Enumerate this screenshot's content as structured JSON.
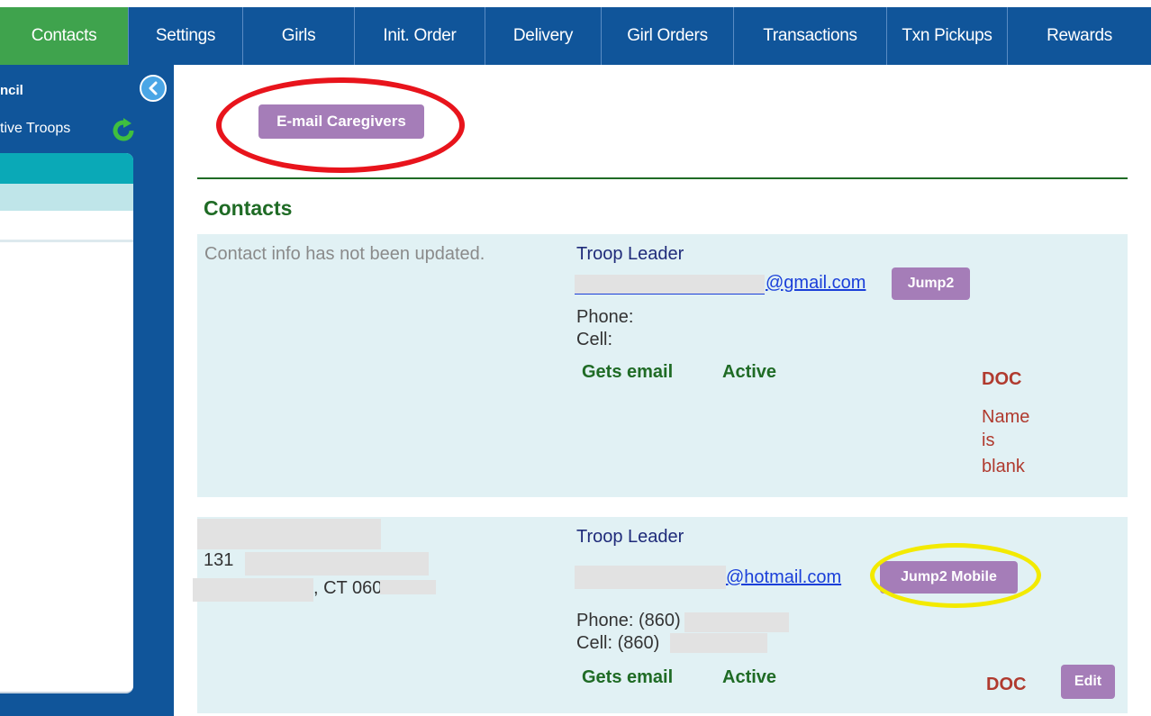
{
  "nav": {
    "tabs": [
      {
        "label": "Contacts",
        "active": true
      },
      {
        "label": "Settings"
      },
      {
        "label": "Girls"
      },
      {
        "label": "Init. Order"
      },
      {
        "label": "Delivery"
      },
      {
        "label": "Girl Orders"
      },
      {
        "label": "Transactions"
      },
      {
        "label": "Txn Pickups"
      },
      {
        "label": "Rewards"
      }
    ]
  },
  "sidebar": {
    "title": "ncil",
    "subtitle": "tive Troops",
    "icons": {
      "collapse": "chevron-left-icon",
      "refresh": "refresh-icon"
    }
  },
  "main": {
    "email_button": "E-mail Caregivers",
    "section_title": "Contacts",
    "contacts": [
      {
        "note": "Contact info has not been updated.",
        "role": "Troop Leader",
        "email_domain": "@gmail.com",
        "jump_button": "Jump2",
        "phone": "Phone:",
        "cell": "Cell:",
        "gets_email": "Gets email",
        "status": "Active",
        "doc": "DOC",
        "doc_note": [
          "Name",
          "is",
          "blank"
        ]
      },
      {
        "address_line1": "131",
        "address_line2": ", CT 060",
        "role": "Troop Leader",
        "email_domain": "@hotmail.com",
        "jump_button": "Jump2 Mobile",
        "phone": "Phone: (860)",
        "cell": "Cell: (860)",
        "gets_email": "Gets email",
        "status": "Active",
        "doc": "DOC",
        "edit_button": "Edit"
      }
    ]
  },
  "colors": {
    "nav_bg": "#10559a",
    "active_tab": "#3fa34d",
    "button": "#a57db8",
    "card_bg": "#e1f1f4",
    "heading_green": "#1f6b25",
    "annotation_red": "#e8141c",
    "annotation_yellow": "#f3ea00"
  }
}
